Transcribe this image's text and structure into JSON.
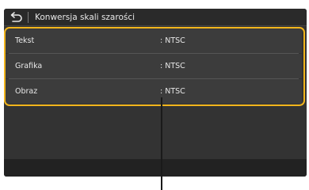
{
  "header": {
    "title": "Konwersja skali szarości",
    "back_icon": "back-arrow-icon"
  },
  "settings": [
    {
      "label": "Tekst",
      "value": ": NTSC"
    },
    {
      "label": "Grafika",
      "value": ": NTSC"
    },
    {
      "label": "Obraz",
      "value": ": NTSC"
    }
  ],
  "colors": {
    "screen_background": "#333333",
    "row_background": "#3c3c3c",
    "highlight": "#f2b51c",
    "text": "#e8e8e8"
  }
}
